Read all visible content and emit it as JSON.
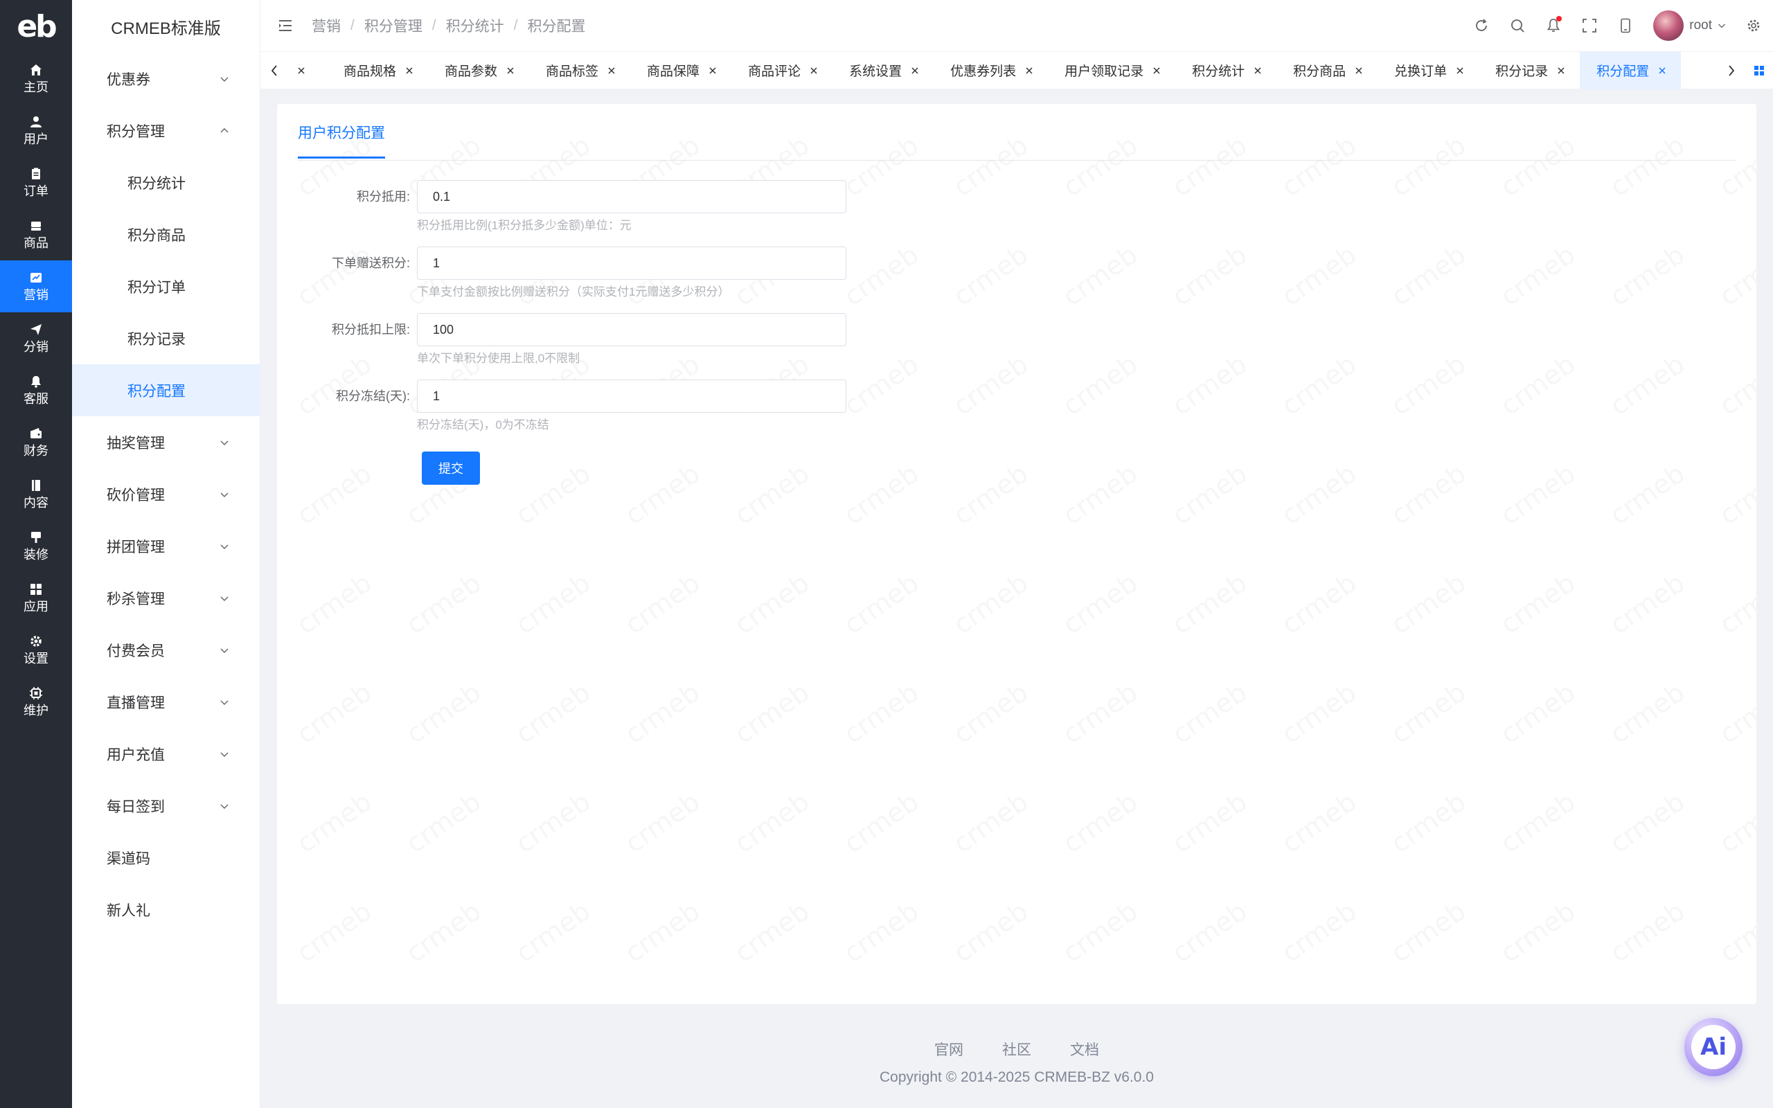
{
  "colors": {
    "primary": "#1677ff",
    "rail_bg": "#282c34",
    "page_bg": "#f0f2f5"
  },
  "rail": {
    "logo": "eb",
    "items": [
      {
        "label": "主页",
        "icon": "home-icon"
      },
      {
        "label": "用户",
        "icon": "user-icon"
      },
      {
        "label": "订单",
        "icon": "clipboard-icon"
      },
      {
        "label": "商品",
        "icon": "box-icon"
      },
      {
        "label": "营销",
        "icon": "chart-icon",
        "active": true
      },
      {
        "label": "分销",
        "icon": "send-icon"
      },
      {
        "label": "客服",
        "icon": "bell-icon"
      },
      {
        "label": "财务",
        "icon": "wallet-icon"
      },
      {
        "label": "内容",
        "icon": "document-icon"
      },
      {
        "label": "装修",
        "icon": "brush-icon"
      },
      {
        "label": "应用",
        "icon": "grid-icon"
      },
      {
        "label": "设置",
        "icon": "gear-icon"
      },
      {
        "label": "维护",
        "icon": "chip-icon"
      }
    ]
  },
  "submenu": {
    "brand": "CRMEB标准版",
    "coupon": "优惠券",
    "points": "积分管理",
    "points_children": [
      "积分统计",
      "积分商品",
      "积分订单",
      "积分记录",
      "积分配置"
    ],
    "groups": [
      "抽奖管理",
      "砍价管理",
      "拼团管理",
      "秒杀管理",
      "付费会员",
      "直播管理",
      "用户充值",
      "每日签到"
    ],
    "channel_code": "渠道码",
    "new_gift": "新人礼"
  },
  "header": {
    "breadcrumb": [
      "营销",
      "积分管理",
      "积分统计",
      "积分配置"
    ],
    "breadcrumb_sep": "/",
    "username": "root"
  },
  "tabs": {
    "items": [
      "商品规格",
      "商品参数",
      "商品标签",
      "商品保障",
      "商品评论",
      "系统设置",
      "优惠券列表",
      "用户领取记录",
      "积分统计",
      "积分商品",
      "兑换订单",
      "积分记录",
      "积分配置"
    ],
    "active_index": 12
  },
  "card": {
    "tab": "用户积分配置",
    "fields": [
      {
        "label": "积分抵用:",
        "value": "0.1",
        "hint": "积分抵用比例(1积分抵多少金额)单位：元"
      },
      {
        "label": "下单赠送积分:",
        "value": "1",
        "hint": "下单支付金额按比例赠送积分（实际支付1元赠送多少积分）"
      },
      {
        "label": "积分抵扣上限:",
        "value": "100",
        "hint": "单次下单积分使用上限,0不限制"
      },
      {
        "label": "积分冻结(天):",
        "value": "1",
        "hint": "积分冻结(天)，0为不冻结"
      }
    ],
    "submit": "提交",
    "watermark": "crmeb"
  },
  "footer": {
    "links": [
      "官网",
      "社区",
      "文档"
    ],
    "copyright": "Copyright © 2014-2025 CRMEB-BZ v6.0.0"
  },
  "ai_button": "Ai"
}
